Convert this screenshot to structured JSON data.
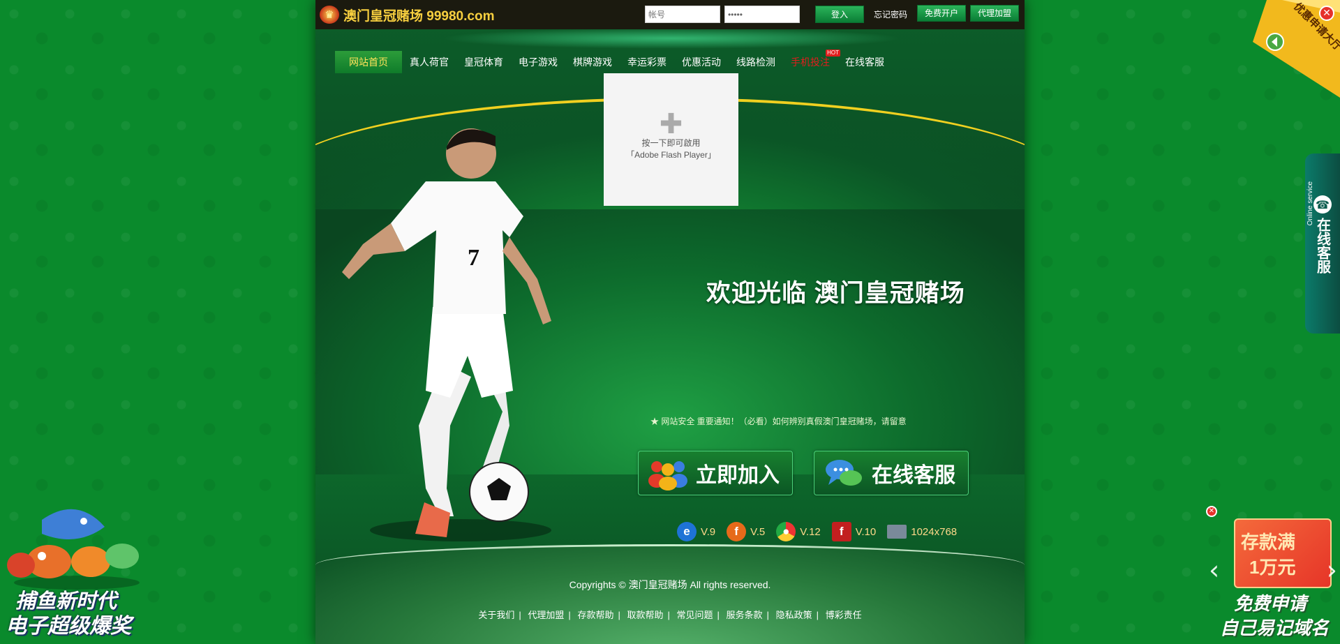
{
  "header": {
    "logo_text": "澳门皇冠赌场 99980.com",
    "username_placeholder": "帐号",
    "password_value": "•••••",
    "login_label": "登入",
    "forgot_label": "忘记密码",
    "register_label": "免费开户",
    "agent_label": "代理加盟"
  },
  "nav": {
    "items": [
      {
        "label": "网站首页",
        "active": true
      },
      {
        "label": "真人荷官"
      },
      {
        "label": "皇冠体育"
      },
      {
        "label": "电子游戏"
      },
      {
        "label": "棋牌游戏"
      },
      {
        "label": "幸运彩票"
      },
      {
        "label": "优惠活动"
      },
      {
        "label": "线路检测"
      },
      {
        "label": "手机投注",
        "hot": true,
        "badge": "HOT"
      },
      {
        "label": "在线客服"
      }
    ]
  },
  "flash": {
    "message": "按一下即可啟用「Adobe Flash Player」"
  },
  "hero": {
    "welcome": "欢迎光临 澳门皇冠赌场",
    "notice": "★ 网站安全 重要通知！（必看）如何辨别真假澳门皇冠赌场，请留意"
  },
  "cta": {
    "join": "立即加入",
    "service": "在线客服"
  },
  "browsers": [
    {
      "icon": "ie-icon",
      "version": "V.9",
      "color": "#1e73d6"
    },
    {
      "icon": "firefox-icon",
      "version": "V.5",
      "color": "#e66a1a"
    },
    {
      "icon": "chrome-icon",
      "version": "V.12",
      "color": "#2f9a3a"
    },
    {
      "icon": "flash-icon",
      "version": "V.10",
      "color": "#c21f1f"
    },
    {
      "icon": "monitor-icon",
      "version": "1024x768",
      "color": "#7a8a9a"
    }
  ],
  "footer": {
    "copyright": "Copyrights © 澳门皇冠赌场 All rights reserved.",
    "links": [
      "关于我们",
      "代理加盟",
      "存款帮助",
      "取款帮助",
      "常见问题",
      "服务条款",
      "隐私政策",
      "博彩责任"
    ]
  },
  "side": {
    "corner_promo": "优惠申请大厅",
    "service_zh": "在线客服",
    "service_en": "Online service",
    "fish_line1": "捕鱼新时代",
    "fish_line2": "电子超级爆奖",
    "deposit_line1": "存款满",
    "deposit_line2": "1万元",
    "deposit_foot1": "免费申请",
    "deposit_foot2": "自己易记域名"
  },
  "colors": {
    "background": "#0a8a2c",
    "nav_active_text": "#ffe35a",
    "hot": "#e21d1d",
    "logo": "#f7cf3f"
  }
}
